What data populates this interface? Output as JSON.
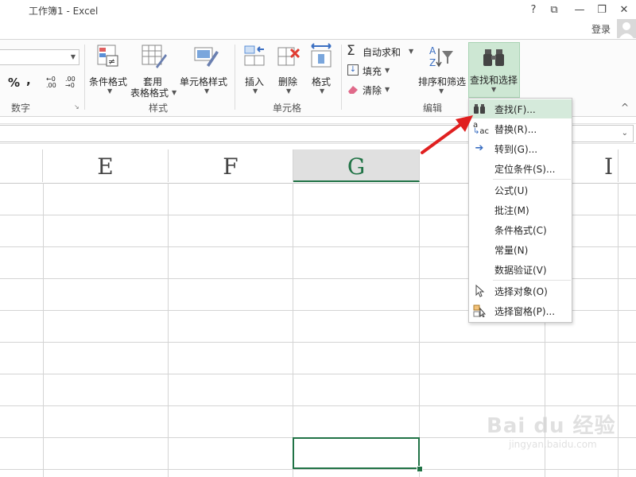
{
  "window": {
    "title": "工作簿1 - Excel",
    "help": "?",
    "restore_ribbon": "⧉",
    "minimize": "—",
    "maximize": "❐",
    "close": "✕"
  },
  "account": {
    "login_label": "登录"
  },
  "ribbon": {
    "number_group": {
      "percent": "%",
      "comma": ",",
      "inc_decimal": "←0 .00",
      "dec_decimal": ".00 →0",
      "label": "数字"
    },
    "styles_group": {
      "conditional_format": "条件格式",
      "table_format_line1": "套用",
      "table_format_line2": "表格格式",
      "cell_styles": "单元格样式",
      "label": "样式"
    },
    "cells_group": {
      "insert": "插入",
      "delete": "删除",
      "format": "格式",
      "label": "单元格"
    },
    "edit_group": {
      "autosum": "自动求和",
      "fill": "填充",
      "clear": "清除",
      "sort_filter": "排序和筛选",
      "find_select": "查找和选择",
      "label": "编辑"
    },
    "collapse": "^"
  },
  "columns": [
    "E",
    "F",
    "G",
    "I"
  ],
  "menu": {
    "items": [
      {
        "label": "查找(F)...",
        "icon": "binoculars-icon"
      },
      {
        "label": "替换(R)...",
        "icon": "replace-icon"
      },
      {
        "label": "转到(G)...",
        "icon": "goto-arrow-icon"
      },
      {
        "label": "定位条件(S)...",
        "icon": ""
      },
      {
        "label": "公式(U)",
        "icon": ""
      },
      {
        "label": "批注(M)",
        "icon": ""
      },
      {
        "label": "条件格式(C)",
        "icon": ""
      },
      {
        "label": "常量(N)",
        "icon": ""
      },
      {
        "label": "数据验证(V)",
        "icon": ""
      },
      {
        "label": "选择对象(O)",
        "icon": "cursor-icon"
      },
      {
        "label": "选择窗格(P)...",
        "icon": "selection-pane-icon"
      }
    ]
  },
  "watermark": {
    "brand": "Bai du 经验",
    "url": "jingyan.baidu.com"
  },
  "colors": {
    "accent": "#217346",
    "highlight": "#d5eadb",
    "arrow": "#e02020"
  }
}
